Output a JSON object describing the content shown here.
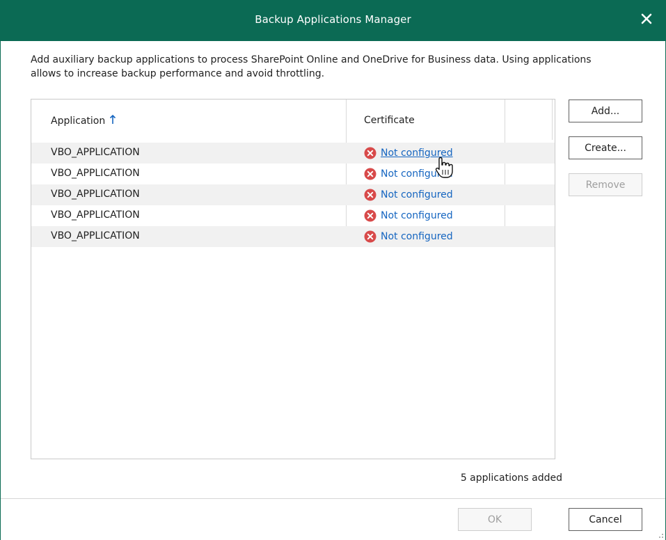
{
  "window": {
    "title": "Backup Applications Manager",
    "accent_color": "#0b6a54"
  },
  "description": "Add auxiliary backup applications to process SharePoint Online and OneDrive for Business data. Using applications allows to increase backup performance and avoid throttling.",
  "table": {
    "columns": [
      {
        "label": "Application",
        "sort": "ascending",
        "sort_icon": "arrow-up-icon"
      },
      {
        "label": "Certificate"
      }
    ],
    "rows": [
      {
        "application": "VBO_APPLICATION",
        "certificate": "Not configured",
        "status_icon": "error-icon"
      },
      {
        "application": "VBO_APPLICATION",
        "certificate": "Not configured",
        "status_icon": "error-icon"
      },
      {
        "application": "VBO_APPLICATION",
        "certificate": "Not configured",
        "status_icon": "error-icon"
      },
      {
        "application": "VBO_APPLICATION",
        "certificate": "Not configured",
        "status_icon": "error-icon"
      },
      {
        "application": "VBO_APPLICATION",
        "certificate": "Not configured",
        "status_icon": "error-icon"
      }
    ]
  },
  "side_buttons": {
    "add": "Add...",
    "create": "Create...",
    "remove": "Remove"
  },
  "status_text": "5 applications added",
  "footer": {
    "ok": "OK",
    "cancel": "Cancel"
  }
}
